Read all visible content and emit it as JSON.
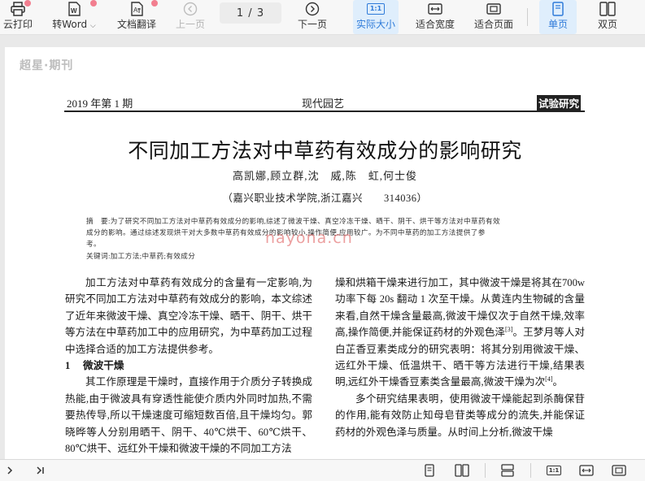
{
  "toolbar": {
    "print_label": "云打印",
    "to_word_label": "转Word",
    "translate_label": "文档翻译",
    "prev_label": "上一页",
    "page_indicator": "1 / 3",
    "next_label": "下一页",
    "actual_size_label": "实际大小",
    "actual_size_icon_text": "1:1",
    "fit_width_label": "适合宽度",
    "fit_page_label": "适合页面",
    "single_page_label": "单页",
    "double_page_label": "双页",
    "accent_color": "#2f7bd9"
  },
  "document": {
    "brand": "超星·期刊",
    "header_left": "2019 年第 1 期",
    "header_center": "现代园艺",
    "header_right": "试验研究",
    "title": "不同加工方法对中草药有效成分的影响研究",
    "authors": "高凯娜,顾立群,沈　威,陈　虹,何士俊",
    "affiliation": "（嘉兴职业技术学院,浙江嘉兴　　314036）",
    "abstract_line1": "摘　要:为了研究不同加工方法对中草药有效成分的影响,综述了微波干燥、真空冷冻干燥、晒干、阴干、烘干等方法对中草药有效",
    "abstract_line2": "成分的影响。通过综述发现烘干对大多数中草药有效成分的影响较小,操作简便,应用较广。为不同中草药的加工方法提供了参",
    "abstract_line3": "考。",
    "keywords": "关键词:加工方法;中草药;有效成分",
    "watermark": "nayona.cn",
    "left_col_para1": "加工方法对中草药有效成分的含量有一定影响,为研究不同加工方法对中草药有效成分的影响，本文综述了近年来微波干燥、真空冷冻干燥、晒干、阴干、烘干等方法在中草药加工中的应用研究，为中草药加工过程中选择合适的加工方法提供参考。",
    "section1": "1　 微波干燥",
    "left_col_para2": "其工作原理是干燥时，直接作用于介质分子转换成热能,由于微波具有穿透性能使介质内外同时加热,不需要热传导,所以干燥速度可缩短数百倍,且干燥均匀。郭晓晔等人分别用晒干、阴干、40℃烘干、60℃烘干、80℃烘干、远红外干燥和微波干燥的不同加工方法",
    "right_col_para1_a": "燥和烘箱干燥来进行加工，其中微波干燥是将其在700w 功率下每 20s 翻动 1 次至干燥。从黄连内生物碱的含量来看,自然干燥含量最高,微波干燥仅次于自然干燥,效率高,操作简便,并能保证药材的外观色泽",
    "right_col_cite1": "[3]",
    "right_col_para1_b": "。王梦月等人对白芷香豆素类成分的研究表明：将其分别用微波干燥、远红外干燥、低温烘干、晒干等方法进行干燥,结果表明,远红外干燥香豆素类含量最高,微波干燥为次",
    "right_col_cite2": "[4]",
    "right_col_para1_c": "。",
    "right_col_para2": "多个研究结果表明，使用微波干燥能起到杀酶保苷的作用,能有效防止知母皂苷类等成分的流失,并能保证药材的外观色泽与质量。从时间上分析,微波干燥"
  }
}
